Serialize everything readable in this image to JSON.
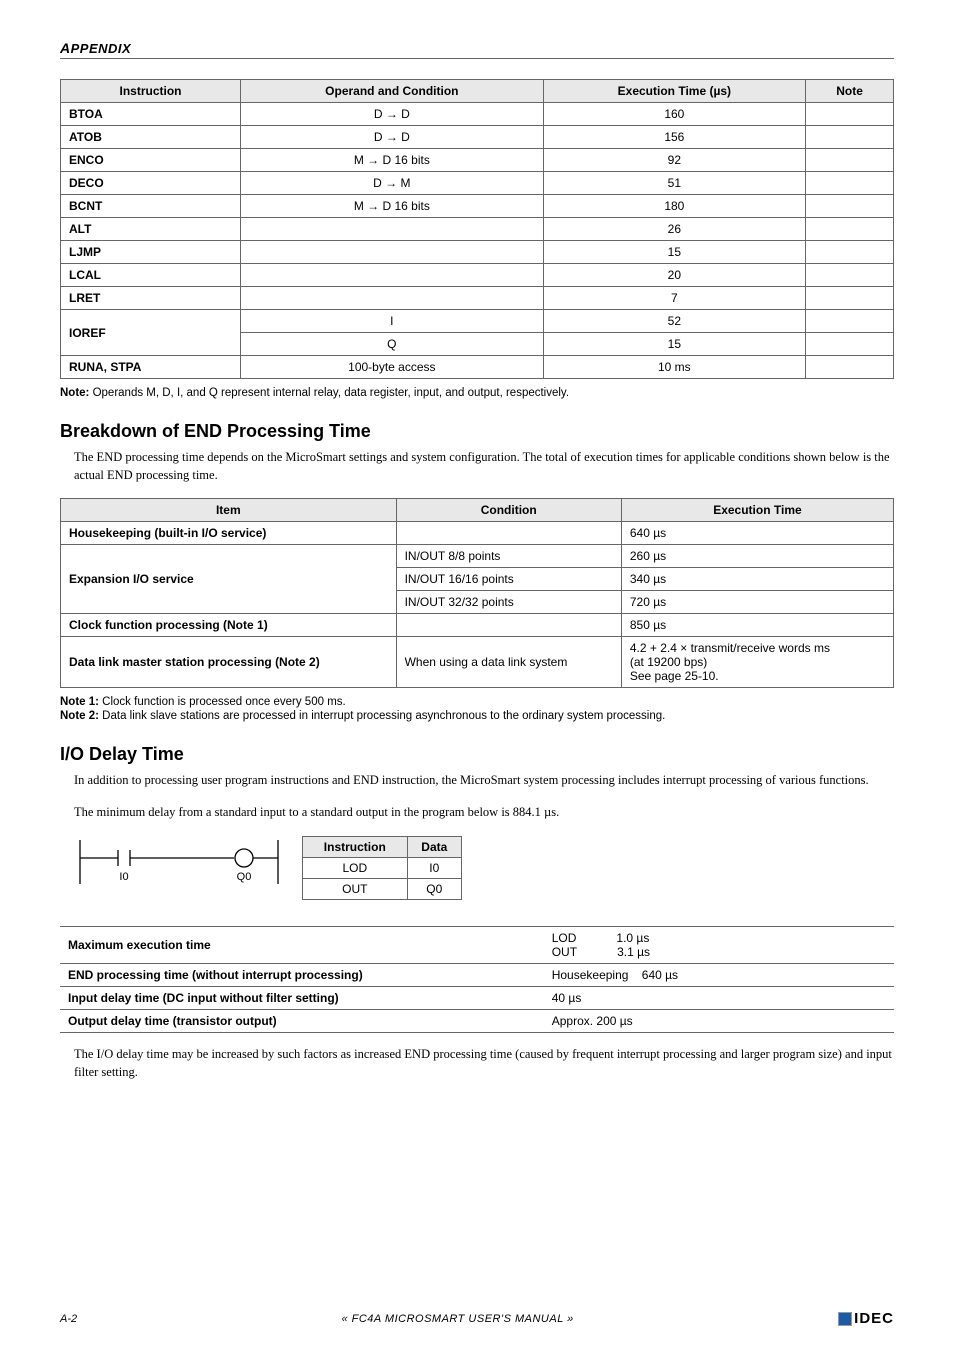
{
  "header": {
    "label_cap": "A",
    "label_rest": "PPENDIX"
  },
  "table1": {
    "headers": [
      "Instruction",
      "Operand and Condition",
      "Execution Time (µs)",
      "Note"
    ],
    "rows": [
      {
        "instr": "BTOA",
        "cond": "D → D",
        "time": "160",
        "note": ""
      },
      {
        "instr": "ATOB",
        "cond": "D → D",
        "time": "156",
        "note": ""
      },
      {
        "instr": "ENCO",
        "cond": "M → D 16 bits",
        "time": "92",
        "note": ""
      },
      {
        "instr": "DECO",
        "cond": "D → M",
        "time": "51",
        "note": ""
      },
      {
        "instr": "BCNT",
        "cond": "M → D 16 bits",
        "time": "180",
        "note": ""
      },
      {
        "instr": "ALT",
        "cond": "",
        "time": "26",
        "note": ""
      },
      {
        "instr": "LJMP",
        "cond": "",
        "time": "15",
        "note": ""
      },
      {
        "instr": "LCAL",
        "cond": "",
        "time": "20",
        "note": ""
      },
      {
        "instr": "LRET",
        "cond": "",
        "time": "7",
        "note": ""
      }
    ],
    "ioref": {
      "instr": "IOREF",
      "rows": [
        {
          "cond": "I",
          "time": "52"
        },
        {
          "cond": "Q",
          "time": "15"
        }
      ]
    },
    "runa": {
      "instr": "RUNA, STPA",
      "cond": "100-byte access",
      "time": "10 ms",
      "note": ""
    }
  },
  "note_t1": {
    "bold": "Note:",
    "text": " Operands M, D, I, and Q represent internal relay, data register, input, and output, respectively."
  },
  "section2": {
    "title": "Breakdown of END Processing Time",
    "para": "The END processing time depends on the MicroSmart settings and system configuration. The total of execution times for applicable conditions shown below is the actual END processing time."
  },
  "table2": {
    "headers": [
      "Item",
      "Condition",
      "Execution Time"
    ],
    "row_hk": {
      "item": "Housekeeping (built-in I/O service)",
      "cond": "",
      "exec": "640 µs"
    },
    "row_exp": {
      "item": "Expansion I/O service",
      "rows": [
        {
          "cond": "IN/OUT 8/8 points",
          "exec": "260 µs"
        },
        {
          "cond": "IN/OUT 16/16 points",
          "exec": "340 µs"
        },
        {
          "cond": "IN/OUT 32/32 points",
          "exec": "720 µs"
        }
      ]
    },
    "row_clock": {
      "item": "Clock function processing (Note 1)",
      "cond": "",
      "exec": "850 µs"
    },
    "row_data": {
      "item": "Data link master station processing (Note 2)",
      "cond": "When using a data link system",
      "exec": "4.2 + 2.4 × transmit/receive words ms\n(at 19200 bps)\nSee page 25-10."
    }
  },
  "note_t2a": {
    "bold": "Note 1:",
    "text": " Clock function is processed once every 500 ms."
  },
  "note_t2b": {
    "bold": "Note 2:",
    "text": " Data link slave stations are processed in interrupt processing asynchronous to the ordinary system processing."
  },
  "section3": {
    "title": "I/O Delay Time",
    "para1": "In addition to processing user program instructions and END instruction, the MicroSmart system processing includes interrupt processing of various functions.",
    "para2": "The minimum delay from a standard input to a standard output in the program below is 884.1 µs."
  },
  "ladder": {
    "i0": "I0",
    "q0": "Q0"
  },
  "table3": {
    "h1": "Instruction",
    "h2": "Data",
    "r1c1": "LOD",
    "r1c2": "I0",
    "r2c1": "OUT",
    "r2c2": "Q0"
  },
  "table4": {
    "r1": {
      "label": "Maximum execution time",
      "v1": "LOD",
      "v2": "1.0 µs",
      "v3": "OUT",
      "v4": "3.1 µs"
    },
    "r2": {
      "label": "END processing time (without interrupt processing)",
      "val": "Housekeeping    640 µs"
    },
    "r3": {
      "label": "Input delay time (DC input without filter setting)",
      "val": "40 µs"
    },
    "r4": {
      "label": "Output delay time (transistor output)",
      "val": "Approx. 200 µs"
    }
  },
  "closing_para": "The I/O delay time may be increased by such factors as increased END processing time (caused by frequent interrupt processing and larger program size) and input filter setting.",
  "footer": {
    "page": "A-2",
    "center": "« FC4A MICROSMART USER'S MANUAL »",
    "logo": "IDEC"
  }
}
